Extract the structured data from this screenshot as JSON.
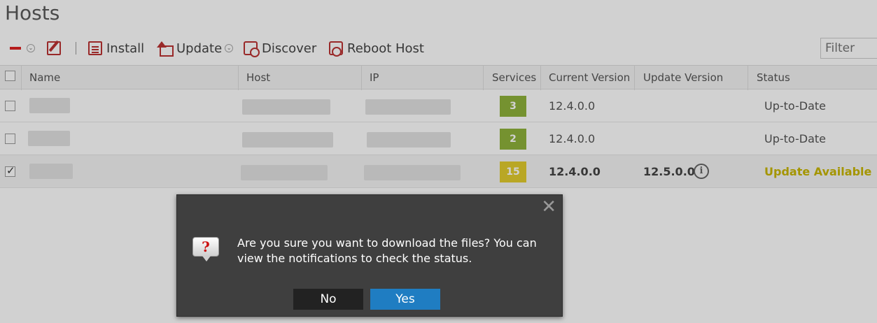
{
  "page": {
    "title": "Hosts"
  },
  "toolbar": {
    "install_label": "Install",
    "update_label": "Update",
    "discover_label": "Discover",
    "reboot_label": "Reboot Host",
    "filter_placeholder": "Filter",
    "caret_glyph": "⌄"
  },
  "table": {
    "columns": [
      "Name",
      "Host",
      "IP",
      "Services",
      "Current Version",
      "Update Version",
      "Status"
    ],
    "rows": [
      {
        "services": "3",
        "current_version": "12.4.0.0",
        "update_version": "",
        "status": "Up-to-Date",
        "checked": false
      },
      {
        "services": "2",
        "current_version": "12.4.0.0",
        "update_version": "",
        "status": "Up-to-Date",
        "checked": false
      },
      {
        "services": "15",
        "current_version": "12.4.0.0",
        "update_version": "12.5.0.0",
        "status": "Update Available",
        "checked": true
      }
    ]
  },
  "dialog": {
    "close_glyph": "✕",
    "icon_glyph": "?",
    "message": "Are you sure you want to download the files? You can view the notifications to check the status.",
    "no_label": "No",
    "yes_label": "Yes"
  },
  "colors": {
    "badge_green": "#8fb33b",
    "badge_yellow": "#e2cc2e",
    "status_available": "#c9b600",
    "yes_button": "#1f7dc2",
    "dialog_bg": "#3f3f3f"
  }
}
